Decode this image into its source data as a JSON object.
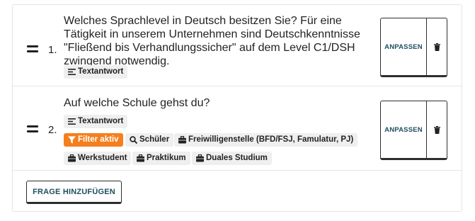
{
  "questions": [
    {
      "number": "1.",
      "text": "Welches Sprachlevel in Deutsch besitzen Sie? Für eine Tätigkeit in unserem Unternehmen sind Deutschkenntnisse \"Fließend bis Verhandlungssicher\" auf dem Level C1/DSH zwingend notwendig.",
      "answer_type": "Textantwort",
      "adapt_label": "ANPASSEN"
    },
    {
      "number": "2.",
      "text": "Auf welche Schule gehst du?",
      "answer_type": "Textantwort",
      "filter_label": "Filter aktiv",
      "filters": [
        "Schüler",
        "Freiwilligenstelle (BFD/FSJ, Famulatur, PJ)",
        "Werkstudent",
        "Praktikum",
        "Duales Studium"
      ],
      "adapt_label": "ANPASSEN"
    }
  ],
  "add_question_label": "FRAGE HINZUFÜGEN",
  "colors": {
    "accent": "#1f4e5f",
    "filter_badge": "#f47f1e",
    "tag_bg": "#efefef"
  },
  "icons": {
    "drag_handle": "drag-handle-icon",
    "text_answer": "text-align-icon",
    "filter": "filter-icon",
    "search": "search-icon",
    "briefcase": "briefcase-icon",
    "delete": "trash-icon"
  }
}
